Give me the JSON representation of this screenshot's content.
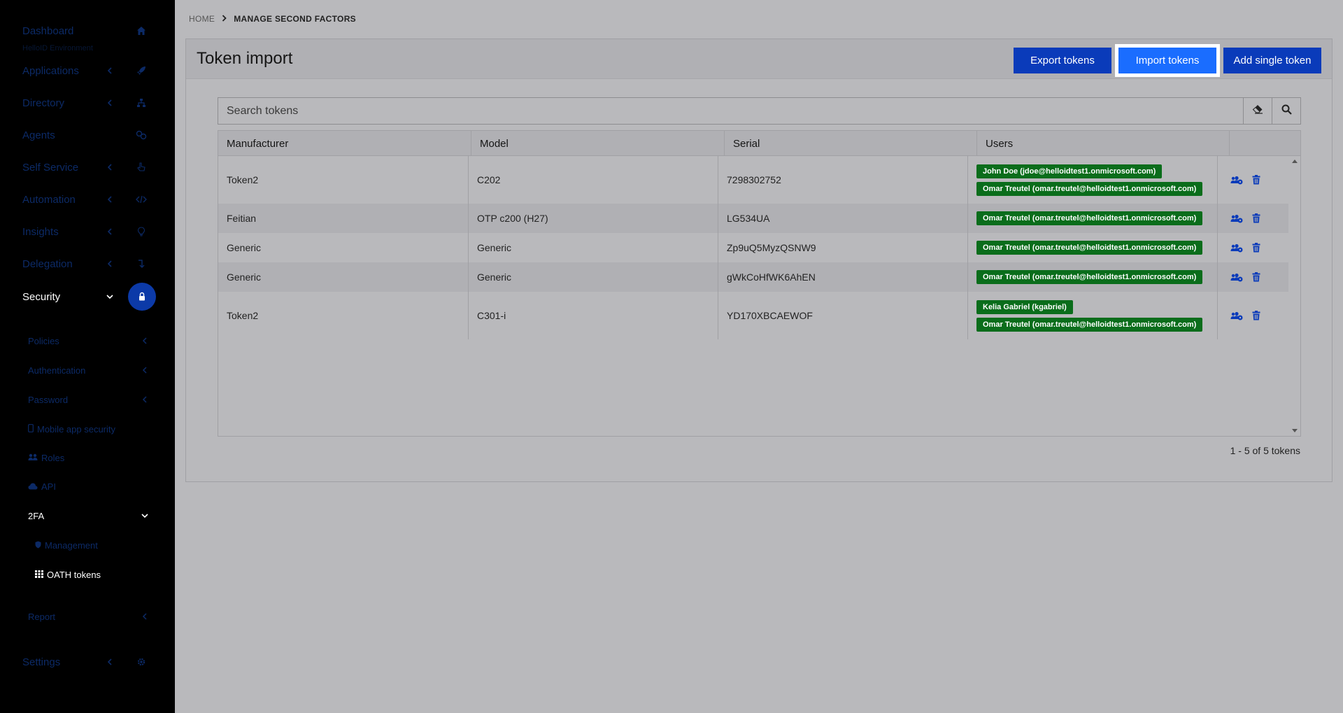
{
  "sidebar": {
    "dashboard_label": "Dashboard",
    "dashboard_sub": "HelloID Environment",
    "items": [
      {
        "label": "Applications"
      },
      {
        "label": "Directory"
      },
      {
        "label": "Agents"
      },
      {
        "label": "Self Service"
      },
      {
        "label": "Automation"
      },
      {
        "label": "Insights"
      },
      {
        "label": "Delegation"
      },
      {
        "label": "Security"
      }
    ],
    "security_sub": [
      {
        "label": "Policies"
      },
      {
        "label": "Authentication"
      },
      {
        "label": "Password"
      },
      {
        "label": "Mobile app security"
      },
      {
        "label": "Roles"
      },
      {
        "label": "API"
      },
      {
        "label": "2FA"
      }
    ],
    "twofa_sub": [
      {
        "label": "Management"
      },
      {
        "label": "OATH tokens"
      }
    ],
    "report_label": "Report",
    "settings_label": "Settings"
  },
  "breadcrumb": {
    "home": "HOME",
    "current": "MANAGE SECOND FACTORS"
  },
  "card": {
    "title": "Token import",
    "export_label": "Export tokens",
    "import_label": "Import tokens",
    "add_label": "Add single token"
  },
  "search": {
    "placeholder": "Search tokens"
  },
  "table": {
    "headers": [
      "Manufacturer",
      "Model",
      "Serial",
      "Users"
    ],
    "rows": [
      {
        "manufacturer": "Token2",
        "model": "C202",
        "serial": "7298302752",
        "users": [
          "John Doe (jdoe@helloidtest1.onmicrosoft.com)",
          "Omar Treutel (omar.treutel@helloidtest1.onmicrosoft.com)"
        ]
      },
      {
        "manufacturer": "Feitian",
        "model": "OTP c200 (H27)",
        "serial": "LG534UA",
        "users": [
          "Omar Treutel (omar.treutel@helloidtest1.onmicrosoft.com)"
        ]
      },
      {
        "manufacturer": "Generic",
        "model": "Generic",
        "serial": "Zp9uQ5MyzQSNW9",
        "users": [
          "Omar Treutel (omar.treutel@helloidtest1.onmicrosoft.com)"
        ]
      },
      {
        "manufacturer": "Generic",
        "model": "Generic",
        "serial": "gWkCoHfWK6AhEN",
        "users": [
          "Omar Treutel (omar.treutel@helloidtest1.onmicrosoft.com)"
        ]
      },
      {
        "manufacturer": "Token2",
        "model": "C301-i",
        "serial": "YD170XBCAEWOF",
        "users": [
          "Kelia Gabriel (kgabriel)",
          "Omar Treutel (omar.treutel@helloidtest1.onmicrosoft.com)"
        ]
      }
    ],
    "count_label": "1 - 5 of 5 tokens"
  },
  "colors": {
    "accent": "#1a6dff",
    "button": "#0a3bba",
    "badge": "#0a6d1b",
    "sidebar": "#000000"
  }
}
